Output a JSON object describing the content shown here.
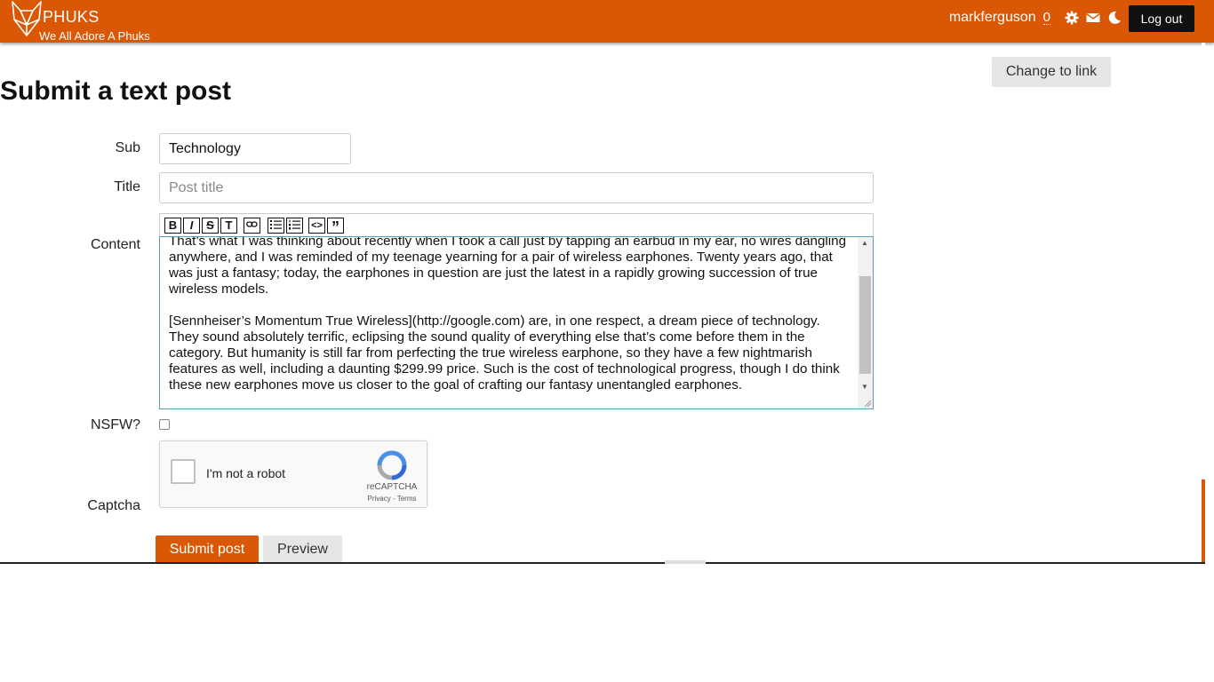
{
  "header": {
    "site_name": "PHUKS",
    "tagline": "We All Adore A Phuks",
    "username": "markferguson",
    "score": "0",
    "logout_label": "Log out",
    "icons": [
      "settings-gear-icon",
      "mail-icon",
      "moon-icon"
    ],
    "brand_color": "#d95705"
  },
  "main": {
    "page_title": "Submit a text post",
    "change_link_label": "Change to link"
  },
  "form": {
    "sub_label": "Sub",
    "sub_value": "Technology",
    "title_label": "Title",
    "title_placeholder": "Post title",
    "content_label": "Content",
    "toolbar": [
      "B",
      "I",
      "S",
      "T",
      "link",
      "bullet-list",
      "numbered-list",
      "code",
      "quote"
    ],
    "content_paragraphs": [
      "That’s what I was thinking about recently when I took a call just by tapping an earbud in my ear, no wires dangling anywhere, and I was reminded of my teenage yearning for a pair of wireless earphones. Twenty years ago, that was just a fantasy; today, the earphones in question are just the latest in a rapidly growing succession of true wireless models.",
      "[Sennheiser’s Momentum True Wireless](http://google.com) are, in one respect, a dream piece of technology. They sound absolutely terrific, eclipsing the sound quality of everything else that’s come before them in the category. But humanity is still far from perfecting the true wireless earphone, so they have a few nightmarish features as well, including a daunting $299.99 price. Such is the cost of technological progress, though I do think these new earphones move us closer to the goal of crafting our fantasy unentangled earphones."
    ],
    "nsfw_label": "NSFW?",
    "nsfw_checked": false,
    "captcha_label": "Captcha",
    "captcha_text": "I'm not a robot",
    "captcha_brand": "reCAPTCHA",
    "captcha_terms": "Privacy - Terms",
    "submit_label": "Submit post",
    "preview_label": "Preview"
  }
}
